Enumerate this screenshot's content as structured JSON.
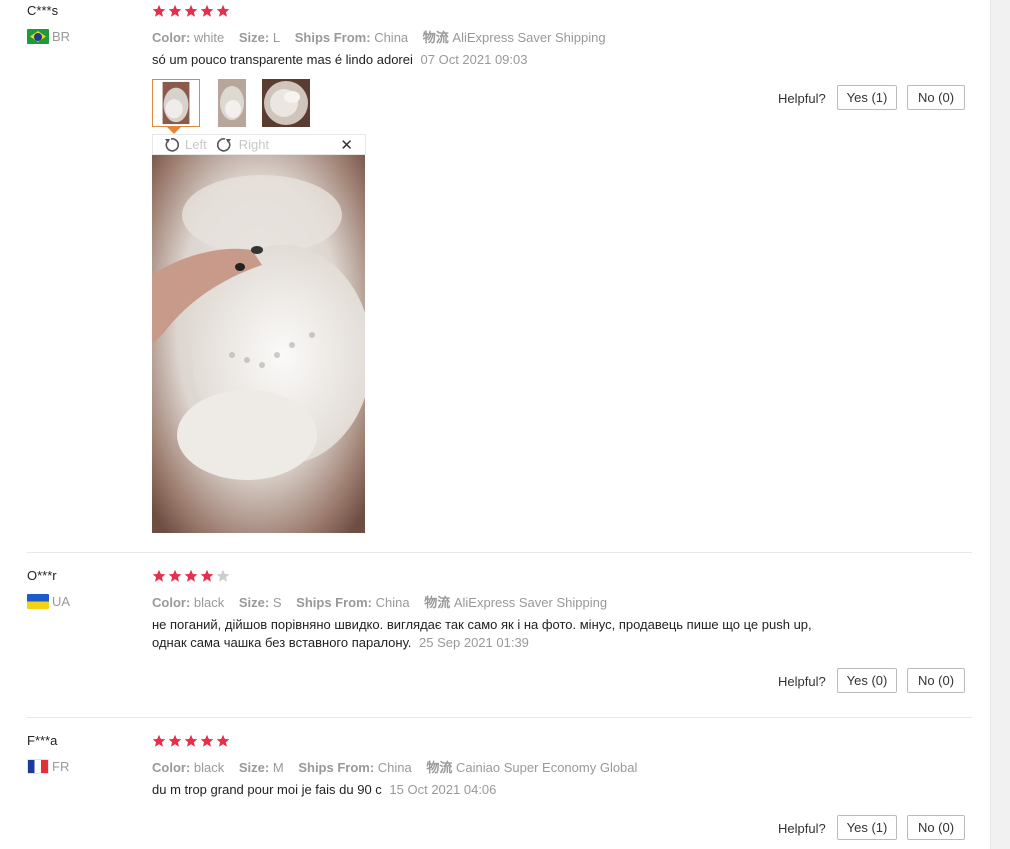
{
  "colors": {
    "star_active": "#e62e4d",
    "star_inactive": "#cccccc",
    "thumb_active_border": "#e0883a"
  },
  "labels": {
    "color_key": "Color:",
    "size_key": "Size:",
    "ships_key": "Ships From:",
    "helpful": "Helpful?"
  },
  "viewer": {
    "rotate_left": "Left",
    "rotate_right": "Right",
    "close_icon": "close-icon"
  },
  "reviews": [
    {
      "user": "C***s",
      "country": "BR",
      "rating": 5,
      "color": "white",
      "size": "L",
      "ships_from": "China",
      "logistics_icon": "物流",
      "shipping": "AliExpress Saver Shipping",
      "text": "só um pouco transparente mas é lindo adorei",
      "date": "07 Oct 2021 09:03",
      "yes": "Yes (1)",
      "no": "No (0)"
    },
    {
      "user": "O***r",
      "country": "UA",
      "rating": 4,
      "color": "black",
      "size": "S",
      "ships_from": "China",
      "logistics_icon": "物流",
      "shipping": "AliExpress Saver Shipping",
      "text_line1": "не поганий, дійшов порівняно швидко. виглядає так само як і на фото. мінус, продавець пише що це push up,",
      "text_line2": "однак сама чашка без вставного паралону.",
      "date": "25 Sep 2021 01:39",
      "yes": "Yes (0)",
      "no": "No (0)"
    },
    {
      "user": "F***a",
      "country": "FR",
      "rating": 5,
      "color": "black",
      "size": "M",
      "ships_from": "China",
      "logistics_icon": "物流",
      "shipping": "Cainiao Super Economy Global",
      "text": "du m trop grand pour moi je fais du 90 c",
      "date": "15 Oct 2021 04:06",
      "yes": "Yes (1)",
      "no": "No (0)"
    }
  ]
}
